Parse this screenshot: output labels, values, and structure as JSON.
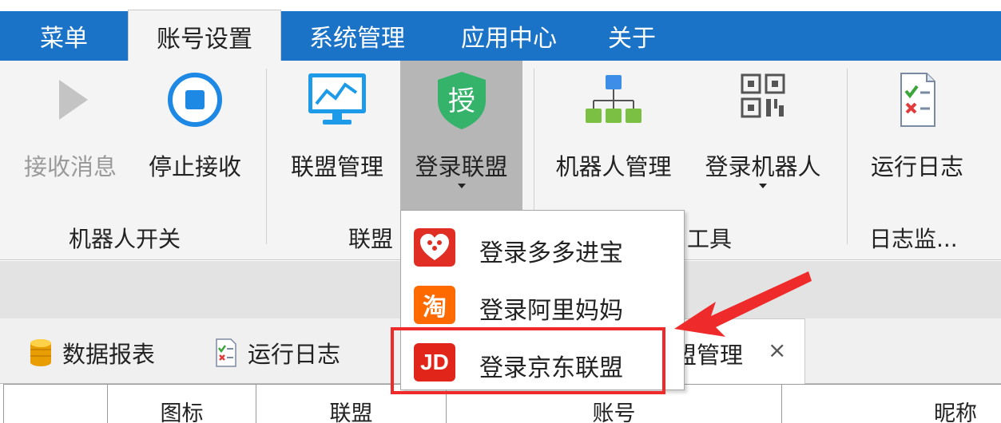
{
  "tabs": [
    {
      "label": "菜单"
    },
    {
      "label": "账号设置"
    },
    {
      "label": "系统管理"
    },
    {
      "label": "应用中心"
    },
    {
      "label": "关于"
    }
  ],
  "ribbon": {
    "buttons": {
      "receive": "接收消息",
      "stop": "停止接收",
      "alliance_manage": "联盟管理",
      "login_alliance": "登录联盟",
      "robot_manage": "机器人管理",
      "login_robot": "登录机器人",
      "run_log": "运行日志"
    },
    "groups": {
      "robot_switch": "机器人开关",
      "alliance": "联盟",
      "tools": "工具",
      "log_monitor": "日志监..."
    },
    "auth_glyph": "授"
  },
  "menu": {
    "items": [
      {
        "label": "登录多多进宝"
      },
      {
        "label": "登录阿里妈妈",
        "glyph": "淘"
      },
      {
        "label": "登录京东联盟",
        "glyph": "JD"
      }
    ]
  },
  "doc_tabs": {
    "report": "数据报表",
    "log": "运行日志",
    "alliance_manage_suffix": "盟管理",
    "close": "×"
  },
  "grid": {
    "headers": [
      "",
      "图标",
      "联盟",
      "账号",
      "昵称"
    ]
  },
  "colors": {
    "ribbon_blue": "#1a73c7",
    "highlight_red": "#ee2a2a",
    "pdd_red": "#e02e24",
    "taobao_orange": "#ff6a00",
    "jd_red": "#e1251b"
  }
}
